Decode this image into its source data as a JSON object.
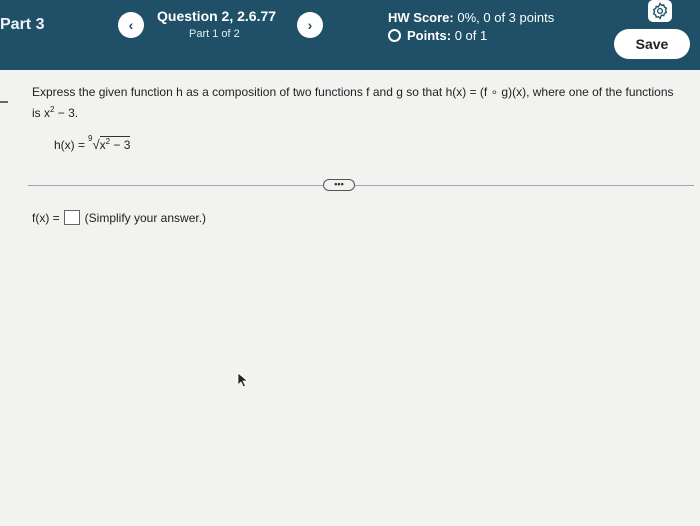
{
  "header": {
    "part_label": "Part 3",
    "prev_label": "‹",
    "next_label": "›",
    "question_title": "Question 2, 2.6.77",
    "question_part": "Part 1 of 2",
    "hw_score_label": "HW Score:",
    "hw_score_value": "0%, 0 of 3 points",
    "points_label": "Points:",
    "points_value": "0 of 1",
    "save_label": "Save"
  },
  "problem": {
    "prompt_line1": "Express the given function h as a composition of two functions f and g so that h(x) = (f ∘ g)(x), where one of the functions",
    "prompt_line2_a": "is x",
    "prompt_line2_exp": "2",
    "prompt_line2_b": " − 3.",
    "given_lhs": "h(x) =",
    "root_index": "9",
    "radical_sign": "√",
    "radicand_base": "x",
    "radicand_exp": "2",
    "radicand_rest": " − 3"
  },
  "more_label": "•••",
  "answer": {
    "label": "f(x) =",
    "value": "",
    "hint": "(Simplify your answer.)"
  },
  "colors": {
    "header_bg": "#1f5067",
    "page_bg": "#f2f2f0"
  }
}
